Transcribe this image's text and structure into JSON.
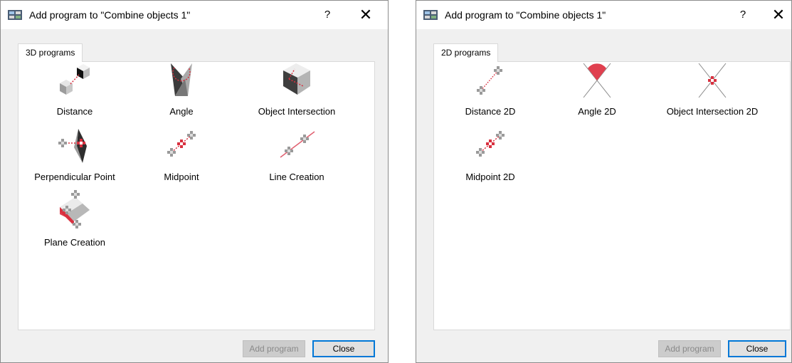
{
  "left": {
    "title": "Add program to \"Combine objects 1\"",
    "help_label": "?",
    "close_glyph": "✕",
    "tab_label": "3D programs",
    "programs": [
      {
        "label": "Distance",
        "icon": "distance-3d-icon"
      },
      {
        "label": "Angle",
        "icon": "angle-3d-icon"
      },
      {
        "label": "Object Intersection",
        "icon": "object-intersection-3d-icon"
      },
      {
        "label": "Perpendicular Point",
        "icon": "perpendicular-point-icon"
      },
      {
        "label": "Midpoint",
        "icon": "midpoint-icon"
      },
      {
        "label": "Line Creation",
        "icon": "line-creation-icon"
      },
      {
        "label": "Plane Creation",
        "icon": "plane-creation-icon"
      }
    ],
    "add_label": "Add program",
    "close_label": "Close"
  },
  "right": {
    "title": "Add program to \"Combine objects 1\"",
    "help_label": "?",
    "close_glyph": "✕",
    "tab_label": "2D programs",
    "programs": [
      {
        "label": "Distance 2D",
        "icon": "distance-2d-icon"
      },
      {
        "label": "Angle 2D",
        "icon": "angle-2d-icon"
      },
      {
        "label": "Object Intersection 2D",
        "icon": "object-intersection-2d-icon"
      },
      {
        "label": "Midpoint 2D",
        "icon": "midpoint-2d-icon"
      }
    ],
    "add_label": "Add program",
    "close_label": "Close"
  },
  "colors": {
    "accent": "#0078d7",
    "highlight_red": "#e0404f",
    "point_gray": "#9a9a9a"
  }
}
